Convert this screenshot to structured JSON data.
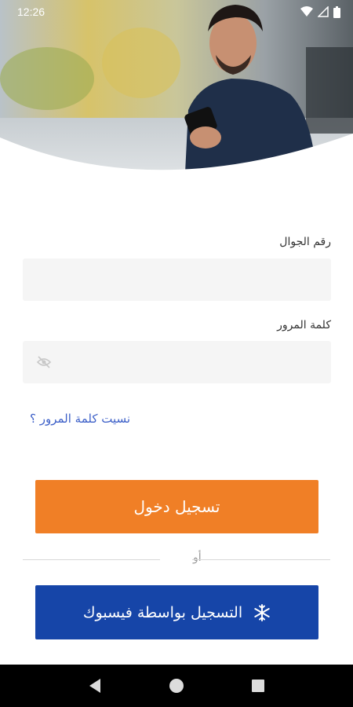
{
  "status_bar": {
    "time": "12:26"
  },
  "form": {
    "phone_label": "رقم الجوال",
    "phone_value": "",
    "password_label": "كلمة المرور",
    "password_value": "",
    "forgot_link": "نسيت كلمة المرور ؟"
  },
  "actions": {
    "login_label": "تسجيل دخول",
    "or_label": "أو",
    "facebook_label": "التسجيل بواسطة فيسبوك"
  },
  "colors": {
    "login_button": "#f07f26",
    "facebook_button": "#1645a8",
    "link": "#3d60c8",
    "field_bg": "#f5f5f5"
  },
  "icons": {
    "password_toggle": "eye-off-icon",
    "facebook": "snowflake-icon"
  }
}
